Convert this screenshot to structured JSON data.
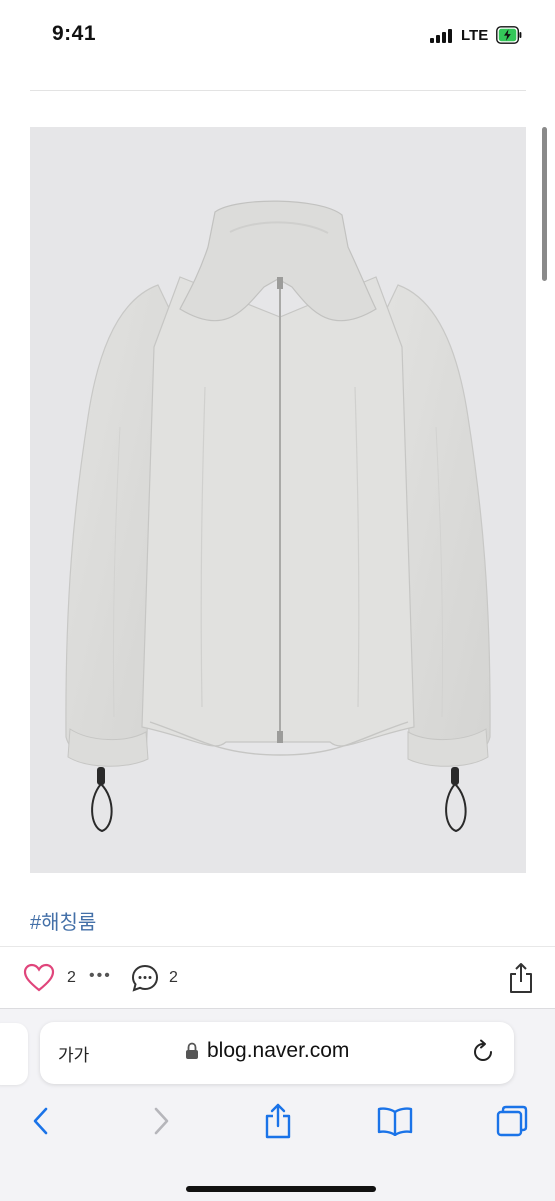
{
  "status_bar": {
    "time": "9:41",
    "network": "LTE",
    "signal_bars": 4,
    "battery_state": "charging",
    "icons": [
      "signal-icon",
      "battery-charging-icon"
    ]
  },
  "post": {
    "image_subject": "light gray hooded zip-up jacket with drawstring cuffs",
    "hashtag": "#해칭룸"
  },
  "reactions": {
    "like_count": "2",
    "more_label": "•••",
    "comment_count": "2",
    "icons": [
      "heart-icon",
      "comment-icon",
      "share-icon"
    ],
    "like_color": "#e0457b"
  },
  "browser": {
    "reader_label": "가가",
    "url": "blog.naver.com",
    "accent": "#1a73e8",
    "icons": [
      "lock-icon",
      "reload-icon",
      "back-icon",
      "forward-icon",
      "share-icon",
      "bookmarks-icon",
      "tabs-icon"
    ]
  }
}
